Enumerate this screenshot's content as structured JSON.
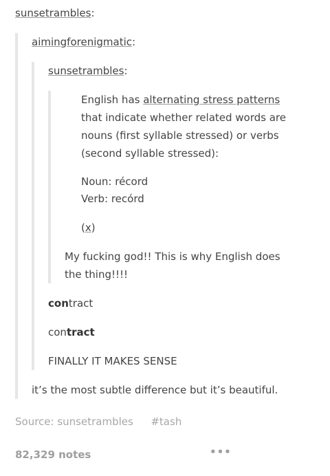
{
  "post": {
    "top_user": "sunsetrambles",
    "level1_user": "aimingforenigmatic",
    "level2_user": "sunsetrambles",
    "colon": ":",
    "original": {
      "pre": "English has ",
      "link": "alternating stress patterns",
      "post": " that indicate whether related words are nouns (first syllable stressed) or verbs (second syllable stressed):",
      "noun": "Noun: récord",
      "verb": "Verb: recórd",
      "x_open": "(",
      "x_link": "x",
      "x_close": ")"
    },
    "reply1": "My fucking god!! This is why English does the thing!!!!",
    "contract1_bold": "con",
    "contract1_rest": "tract",
    "contract2_rest": "con",
    "contract2_bold": "tract",
    "finally": "FINALLY IT MAKES SENSE",
    "reply2": "it’s the most subtle difference but it’s beautiful."
  },
  "footer": {
    "source_label": "Source: sunsetrambles",
    "tag": "#tash",
    "notes": "82,329 notes",
    "more": "•••"
  }
}
